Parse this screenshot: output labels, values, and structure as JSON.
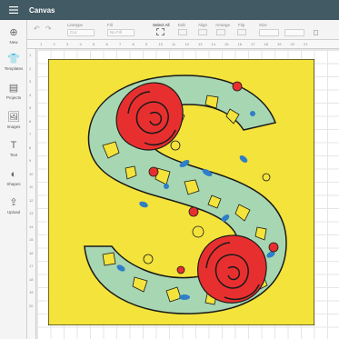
{
  "app": {
    "title": "Canvas"
  },
  "icons": {
    "menu": "hamburger-menu-icon",
    "undo": "undo-icon",
    "redo": "redo-icon"
  },
  "toolbar": {
    "select_all_label": "Select All",
    "linetype_label": "Linetype",
    "linetype_value": "Cut",
    "fill_label": "Fill",
    "fill_value": "No Fill",
    "edit_label": "Edit",
    "align_label": "Align",
    "arrange_label": "Arrange",
    "flip_label": "Flip",
    "size_label": "Size"
  },
  "sidebar": {
    "items": [
      {
        "label": "New",
        "icon": "plus-circle-icon"
      },
      {
        "label": "Templates",
        "icon": "tshirt-icon"
      },
      {
        "label": "Projects",
        "icon": "projects-icon"
      },
      {
        "label": "Images",
        "icon": "image-icon"
      },
      {
        "label": "Text",
        "icon": "text-icon"
      },
      {
        "label": "Shapes",
        "icon": "shapes-icon"
      },
      {
        "label": "Upload",
        "icon": "upload-icon"
      }
    ]
  },
  "ruler": {
    "top": [
      "1",
      "2",
      "3",
      "4",
      "5",
      "6",
      "7",
      "8",
      "9",
      "10",
      "11",
      "12",
      "13",
      "14",
      "15",
      "16",
      "17",
      "18",
      "19",
      "20",
      "21"
    ],
    "left": [
      "1",
      "2",
      "3",
      "4",
      "5",
      "6",
      "7",
      "8",
      "9",
      "10",
      "11",
      "12",
      "13",
      "14",
      "15",
      "16",
      "17",
      "18",
      "19",
      "20"
    ]
  },
  "colors": {
    "header": "#425a63",
    "background_square": "#f3e33b",
    "letter_fill": "#a7d7b2",
    "rose": "#e82f2f",
    "accent_blue": "#2f7ec8",
    "outline": "#1a1a1a"
  }
}
